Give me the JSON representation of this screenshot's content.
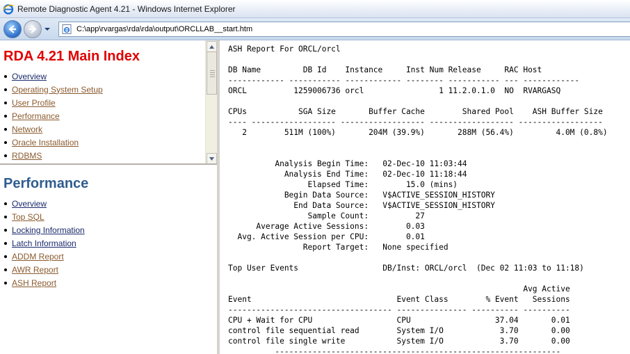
{
  "window": {
    "title": "Remote Diagnostic Agent 4.21 - Windows Internet Explorer"
  },
  "address": {
    "url": "C:\\app\\rvargas\\rda\\rda\\output\\ORCLLAB__start.htm"
  },
  "main_index": {
    "title": "RDA 4.21 Main Index",
    "items": [
      {
        "label": "Overview",
        "visited": false
      },
      {
        "label": "Operating System Setup",
        "visited": true
      },
      {
        "label": "User Profile",
        "visited": true
      },
      {
        "label": "Performance",
        "visited": true
      },
      {
        "label": "Network",
        "visited": true
      },
      {
        "label": "Oracle Installation",
        "visited": true
      },
      {
        "label": "RDBMS",
        "visited": true
      }
    ]
  },
  "performance": {
    "title": "Performance",
    "items": [
      {
        "label": "Overview",
        "visited": false
      },
      {
        "label": "Top SQL",
        "visited": true
      },
      {
        "label": "Locking Information",
        "visited": false
      },
      {
        "label": "Latch Information",
        "visited": false
      },
      {
        "label": "ADDM Report",
        "visited": true
      },
      {
        "label": "AWR Report",
        "visited": true
      },
      {
        "label": "ASH Report",
        "visited": true
      }
    ]
  },
  "report": {
    "lines": [
      "ASH Report For ORCL/orcl",
      "",
      "DB Name         DB Id    Instance     Inst Num Release     RAC Host",
      "------------ ----------- ------------ -------- ----------- --- ------------",
      "ORCL          1259006736 orcl                1 11.2.0.1.0  NO  RVARGASQ",
      "",
      "CPUs           SGA Size       Buffer Cache        Shared Pool    ASH Buffer Size",
      "---- ------------------ ------------------ ------------------ ------------------",
      "   2        511M (100%)       204M (39.9%)       288M (56.4%)         4.0M (0.8%)",
      "",
      "",
      "          Analysis Begin Time:   02-Dec-10 11:03:44",
      "            Analysis End Time:   02-Dec-10 11:18:44",
      "                 Elapsed Time:        15.0 (mins)",
      "            Begin Data Source:   V$ACTIVE_SESSION_HISTORY",
      "              End Data Source:   V$ACTIVE_SESSION_HISTORY",
      "                 Sample Count:          27",
      "      Average Active Sessions:        0.03",
      "  Avg. Active Session per CPU:        0.01",
      "                Report Target:   None specified",
      "",
      "Top User Events                  DB/Inst: ORCL/orcl  (Dec 02 11:03 to 11:18)",
      "",
      "                                                               Avg Active",
      "Event                               Event Class        % Event   Sessions",
      "----------------------------------- --------------- ---------- ----------",
      "CPU + Wait for CPU                  CPU                  37.04       0.01",
      "control file sequential read        System I/O            3.70       0.00",
      "control file single write           System I/O            3.70       0.00",
      "          -------------------------------------------------------------"
    ]
  }
}
